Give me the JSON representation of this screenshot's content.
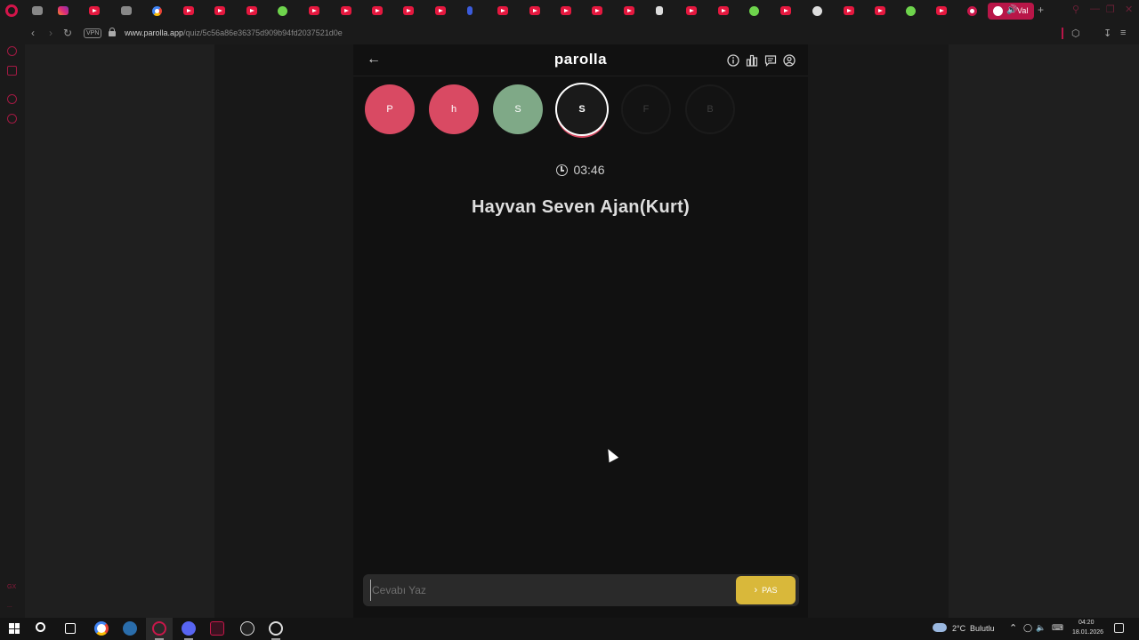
{
  "browser": {
    "active_tab_label": "Val",
    "url_domain": "www.parolla.app",
    "url_path": "/quiz/5c56a86e36375d909b94fd2037521d0e",
    "vpn_badge": "VPN",
    "accent_color": "#d3154a"
  },
  "app": {
    "brand": "parolla",
    "back_icon": "arrow-left-icon",
    "header_icons": [
      "info-icon",
      "stats-icon",
      "comments-icon",
      "user-icon"
    ]
  },
  "letters": [
    {
      "char": "P",
      "status": "wrong"
    },
    {
      "char": "h",
      "status": "wrong"
    },
    {
      "char": "S",
      "status": "correct"
    },
    {
      "char": "S",
      "status": "current"
    },
    {
      "char": "F",
      "status": "pending"
    },
    {
      "char": "B",
      "status": "pending"
    }
  ],
  "colors": {
    "wrong": "#d94a63",
    "correct": "#7fa987",
    "pass": "#d9b83a"
  },
  "timer": "03:46",
  "question": "Hayvan Seven Ajan(Kurt)",
  "answer": {
    "placeholder": "Cevabı Yaz",
    "value": "",
    "pass_label": "PAS"
  },
  "sidebar": {
    "bottom_label": "GX",
    "more_label": "..."
  },
  "taskbar": {
    "weather": "2°C",
    "weather_desc": "Bulutlu",
    "time": "04:20",
    "date": "18.01.2026"
  }
}
